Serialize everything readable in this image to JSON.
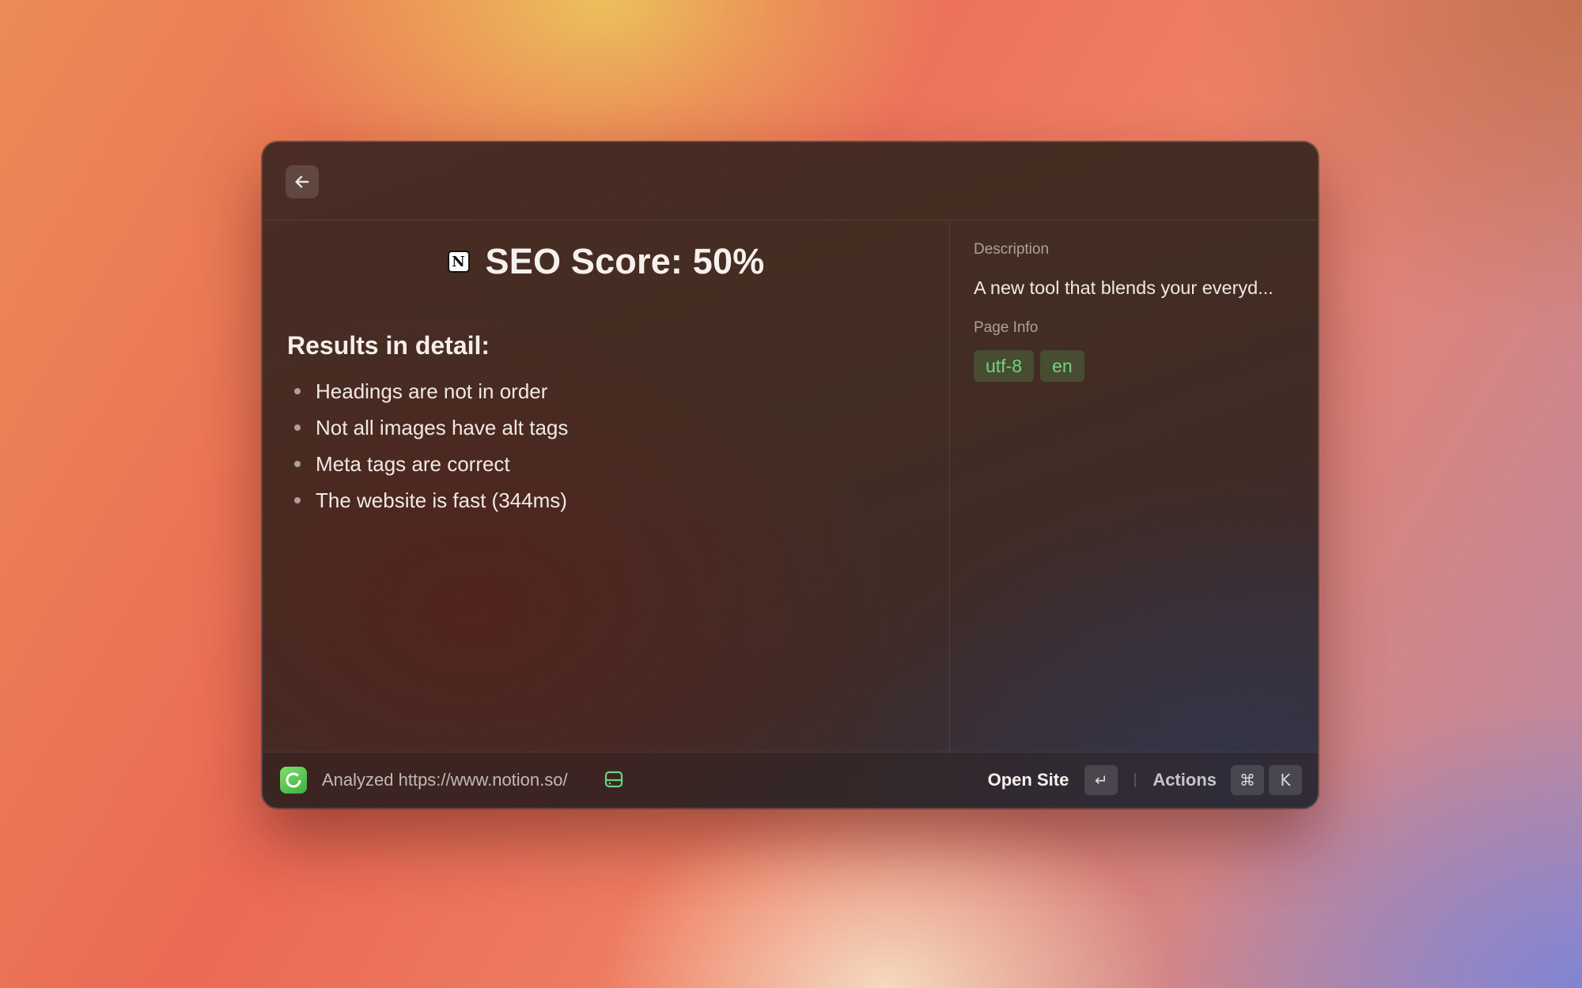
{
  "toolbar": {
    "back_icon": "arrow-left-icon"
  },
  "main": {
    "site_icon": "notion-logo-icon",
    "logo_letter": "N",
    "score_title": "SEO Score: 50%",
    "results_heading": "Results in detail:",
    "results": [
      "Headings are not in order",
      "Not all images have alt tags",
      "Meta tags are correct",
      "The website is fast (344ms)"
    ]
  },
  "side": {
    "description_label": "Description",
    "description_text": "A new tool that blends your everyd...",
    "page_info_label": "Page Info",
    "tags": [
      "utf-8",
      "en"
    ]
  },
  "footer": {
    "status_text": "Analyzed https://www.notion.so/",
    "primary_action": "Open Site",
    "primary_key": "↵",
    "actions_label": "Actions",
    "actions_keys": [
      "⌘",
      "K"
    ]
  },
  "colors": {
    "tag_text": "#72d57e",
    "app_icon": "#5cc857"
  }
}
